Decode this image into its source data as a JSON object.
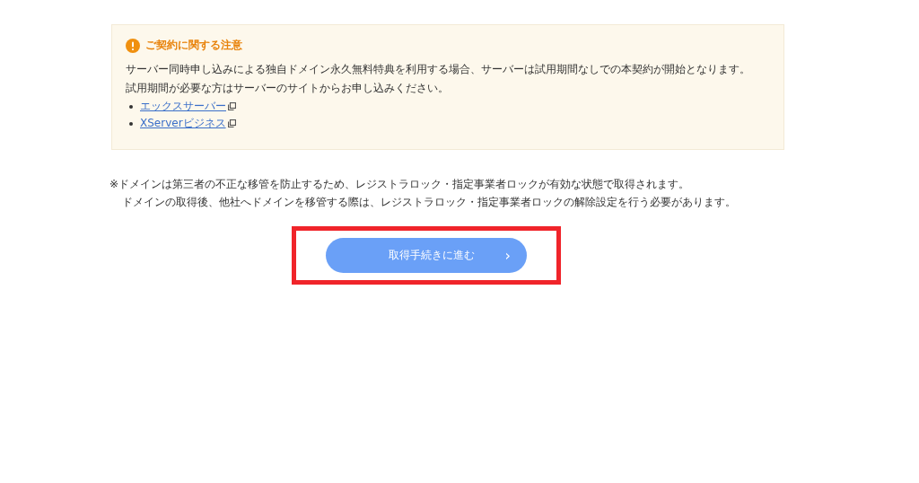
{
  "notice": {
    "title": "ご契約に関する注意",
    "lines": [
      "サーバー同時申し込みによる独自ドメイン永久無料特典を利用する場合、サーバーは試用期間なしでの本契約が開始となります。",
      "試用期間が必要な方はサーバーのサイトからお申し込みください。"
    ],
    "links": [
      "エックスサーバー",
      "XServerビジネス"
    ]
  },
  "footnote": [
    "※ドメインは第三者の不正な移管を防止するため、レジストラロック・指定事業者ロックが有効な状態で取得されます。",
    "ドメインの取得後、他社へドメインを移管する際は、レジストラロック・指定事業者ロックの解除設定を行う必要があります。"
  ],
  "proceed_button": {
    "label": "取得手続きに進む",
    "chevron": "›",
    "highlighted": true
  }
}
